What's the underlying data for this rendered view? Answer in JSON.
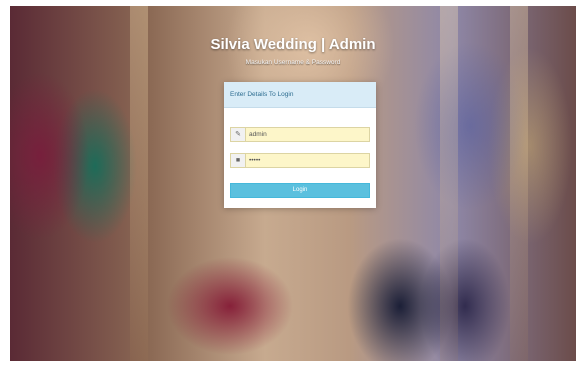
{
  "header": {
    "title": "Silvia Wedding | Admin",
    "subtitle": "Masukan Username & Password"
  },
  "login_panel": {
    "heading": "Enter Details To Login",
    "username": {
      "icon": "user-icon",
      "value": "admin"
    },
    "password": {
      "icon": "lock-icon",
      "value": "•••••"
    },
    "submit_label": "Login"
  },
  "colors": {
    "panel_header_bg": "#d9ecf7",
    "input_bg": "#fdf6c9",
    "button_bg": "#5bc0de",
    "title_text": "#ffffff"
  }
}
